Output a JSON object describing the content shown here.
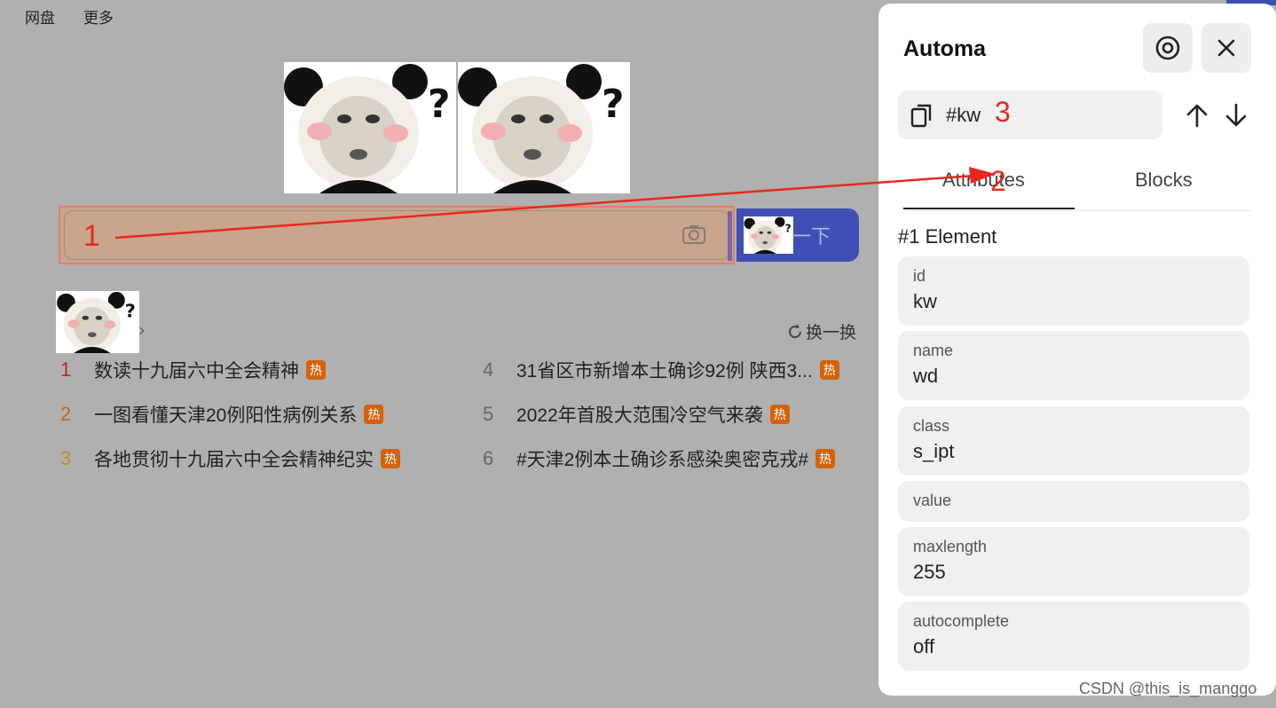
{
  "topnav": {
    "item1": "网盘",
    "item2": "更多"
  },
  "search": {
    "annotation": "1",
    "button_label": "一下"
  },
  "hotlist": {
    "refresh_label": "换一换",
    "hot_tag": "热",
    "items": [
      {
        "num": "1",
        "text": "数读十九届六中全会精神",
        "color": "#c0281e"
      },
      {
        "num": "2",
        "text": "一图看懂天津20例阳性病例关系",
        "color": "#d4620a"
      },
      {
        "num": "3",
        "text": "各地贯彻十九届六中全会精神纪实",
        "color": "#c08a2a"
      },
      {
        "num": "4",
        "text": "31省区市新增本土确诊92例 陕西3...",
        "color": "#666666"
      },
      {
        "num": "5",
        "text": "2022年首股大范围冷空气来袭",
        "color": "#666666"
      },
      {
        "num": "6",
        "text": "#天津2例本土确诊系感染奥密克戎#",
        "color": "#666666"
      }
    ]
  },
  "panel": {
    "title": "Automa",
    "selector": "#kw",
    "selector_annotation": "3",
    "tabs": {
      "attributes": "Attributes",
      "blocks": "Blocks"
    },
    "tab_annotation": "2",
    "element_title": "#1 Element",
    "attributes": [
      {
        "key": "id",
        "value": "kw"
      },
      {
        "key": "name",
        "value": "wd"
      },
      {
        "key": "class",
        "value": "s_ipt"
      },
      {
        "key": "value",
        "value": ""
      },
      {
        "key": "maxlength",
        "value": "255"
      },
      {
        "key": "autocomplete",
        "value": "off"
      }
    ]
  },
  "watermark": "CSDN @this_is_manggo",
  "colors": {
    "accent_blue": "#3f4fb5",
    "annotation_red": "#e8281e",
    "hot_orange": "#d4620a"
  }
}
